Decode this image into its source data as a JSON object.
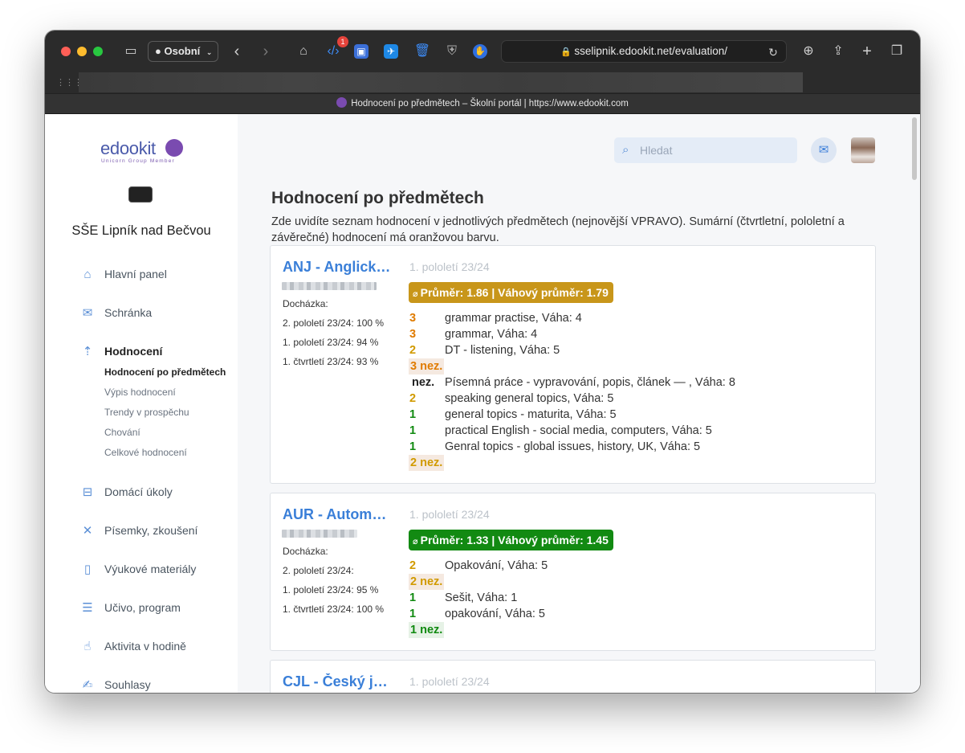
{
  "browser": {
    "profile_label": "Osobní",
    "extension_badge": "1",
    "url": "sselipnik.edookit.net/evaluation/",
    "tab_title": "Hodnocení po předmětech – Školní portál | https://www.edookit.com"
  },
  "sidebar": {
    "logo_text": "edookit",
    "logo_subtitle": "Unicorn Group Member",
    "school_name": "SŠE Lipník nad Bečvou",
    "nav": {
      "dashboard": "Hlavní panel",
      "inbox": "Schránka",
      "evaluation": "Hodnocení",
      "homework": "Domácí úkoly",
      "tests": "Písemky, zkoušení",
      "materials": "Výukové materiály",
      "curriculum": "Učivo, program",
      "activity": "Aktivita v hodině",
      "consents": "Souhlasy"
    },
    "sub": {
      "by_subject": "Hodnocení po předmětech",
      "list": "Výpis hodnocení",
      "trends": "Trendy v prospěchu",
      "behavior": "Chování",
      "overall": "Celkové hodnocení"
    }
  },
  "header": {
    "search_placeholder": "Hledat"
  },
  "page": {
    "title": "Hodnocení po předmětech",
    "description": "Zde uvidíte seznam hodnocení v jednotlivých předmětech (nejnovější VPRAVO). Sumární (čtvrtletní, pololetní a závěrečné) hodnocení má oranžovou barvu."
  },
  "subjects": [
    {
      "name": "ANJ - Anglický jazyk",
      "period": "1. pololetí 23/24",
      "attendance_label": "Docházka:",
      "attendance": [
        "2. pololetí 23/24: 100 %",
        "1. pololetí 23/24: 94 %",
        "1. čtvrtletí 23/24: 93 %"
      ],
      "average_label": "Průměr: 1.86 | Váhový průměr: 1.79",
      "average_color": "#c8961a",
      "grades": [
        {
          "value": "3",
          "text": "grammar practise, Váha: 4",
          "color": "#e07b00"
        },
        {
          "value": "3",
          "text": "grammar, Váha: 4",
          "color": "#e07b00"
        },
        {
          "value": "2",
          "text": "DT - listening, Váha: 5",
          "color": "#d19a00"
        },
        {
          "value": "3 nez.",
          "text": "",
          "color": "#e07b00"
        },
        {
          "value": "nez.",
          "text": "Písemná práce - vypravování, popis, článek — , Váha: 8",
          "color": "#222222"
        },
        {
          "value": "2",
          "text": "speaking general topics, Váha: 5",
          "color": "#d19a00"
        },
        {
          "value": "1",
          "text": "general topics - maturita, Váha: 5",
          "color": "#108a10"
        },
        {
          "value": "1",
          "text": "practical English - social media, computers, Váha: 5",
          "color": "#108a10"
        },
        {
          "value": "1",
          "text": "Genral topics - global issues, history, UK, Váha: 5",
          "color": "#108a10"
        },
        {
          "value": "2 nez.",
          "text": "",
          "color": "#d19a00"
        }
      ]
    },
    {
      "name": "AUR - Automatizace",
      "period": "1. pololetí 23/24",
      "attendance_label": "Docházka:",
      "attendance": [
        "2. pololetí 23/24:",
        "1. pololetí 23/24: 95 %",
        "1. čtvrtletí 23/24: 100 %"
      ],
      "average_label": "Průměr: 1.33 | Váhový průměr: 1.45",
      "average_color": "#128a12",
      "grades": [
        {
          "value": "2",
          "text": "Opakování, Váha: 5",
          "color": "#d19a00"
        },
        {
          "value": "2 nez.",
          "text": "",
          "color": "#d19a00"
        },
        {
          "value": "1",
          "text": "Sešit, Váha: 1",
          "color": "#108a10"
        },
        {
          "value": "1",
          "text": "opakování, Váha: 5",
          "color": "#108a10"
        },
        {
          "value": "1 nez.",
          "text": "",
          "color": "#108a10"
        }
      ]
    },
    {
      "name": "CJL - Český jazyk a literatura",
      "period": "1. pololetí 23/24"
    }
  ]
}
